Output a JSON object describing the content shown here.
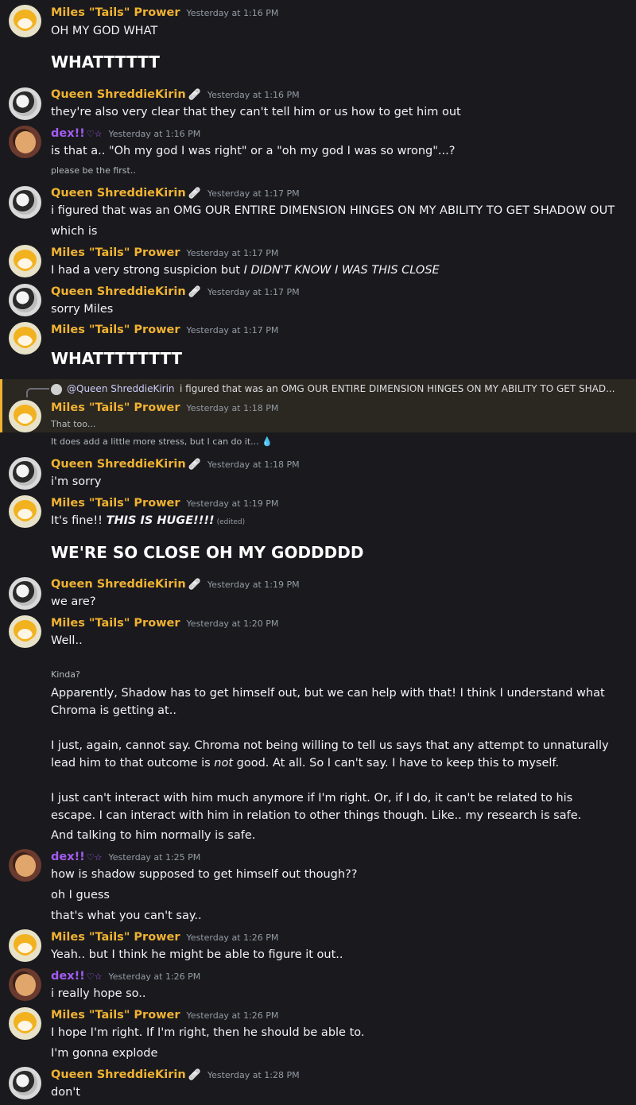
{
  "users": {
    "tails": {
      "name": "Miles \"Tails\" Prower"
    },
    "queen": {
      "name": "Queen ShreddieKirin",
      "badge": "🩹"
    },
    "dex": {
      "name": "dex!!",
      "badge": "♡☆"
    }
  },
  "timestamps": {
    "t1": "Yesterday at 1:16 PM",
    "t2": "Yesterday at 1:17 PM",
    "t3": "Yesterday at 1:18 PM",
    "t4": "Yesterday at 1:19 PM",
    "t5": "Yesterday at 1:20 PM",
    "t6": "Yesterday at 1:25 PM",
    "t7": "Yesterday at 1:26 PM",
    "t8": "Yesterday at 1:28 PM"
  },
  "messages": {
    "m1": "OH MY GOD WHAT",
    "m1b": "WHATTTTTT",
    "m2": "they're also very clear that they can't tell him or us how to get him out",
    "m3": "is that a.. \"Oh my god I was right\" or a \"oh my god I was so wrong\"...?",
    "m3s": "please be the first..",
    "m4": "i figured that was an OMG OUR ENTIRE DIMENSION HINGES ON MY ABILITY TO GET SHADOW OUT",
    "m4b": "which is",
    "m5a": "I had a very strong suspicion but ",
    "m5b": "I DIDN'T KNOW I WAS THIS CLOSE",
    "m6": "sorry Miles",
    "m7": "WHATTTTTTTT",
    "reply_mention": "@Queen ShreddieKirin",
    "reply_text": "i figured that was an OMG OUR ENTIRE DIMENSION HINGES ON MY ABILITY TO GET SHAD...",
    "m8": "That too...",
    "m8b": "It does add a little more stress, but I can do it...",
    "m8b_emoji": "💧",
    "m9": "i'm sorry",
    "m10a": "It's fine!! ",
    "m10b": "THIS IS HUGE!!!!",
    "m10_edited": "(edited)",
    "m10c": "WE'RE SO CLOSE OH MY GODDDDD",
    "m11": "we are?",
    "m12": "Well..",
    "m12b": "Kinda?",
    "m12c": "Apparently, Shadow has to get himself out, but we can help with that! I think I understand what Chroma is getting at..",
    "m12d1": "I just, again, cannot say. Chroma not being willing to tell us says that any attempt to unnaturally lead him to that outcome is ",
    "m12d2": "not",
    "m12d3": " good. At all. So I can't say. I have to keep this to myself.",
    "m12e": "I just can't interact with him much anymore if I'm right. Or, if I do, it can't be related to his escape. I can interact with him in relation to other things though. Like.. my research is safe.",
    "m12f": "And talking to him normally is safe.",
    "m13": "how is shadow supposed to get himself out though??",
    "m13b": "oh I guess",
    "m13c": "that's what you can't say..",
    "m14": "Yeah.. but I think he might be able to figure it out..",
    "m15": "i really hope so..",
    "m16": "I hope I'm right. If I'm right, then he should be able to.",
    "m16b": "I'm gonna explode",
    "m17": "don't"
  }
}
